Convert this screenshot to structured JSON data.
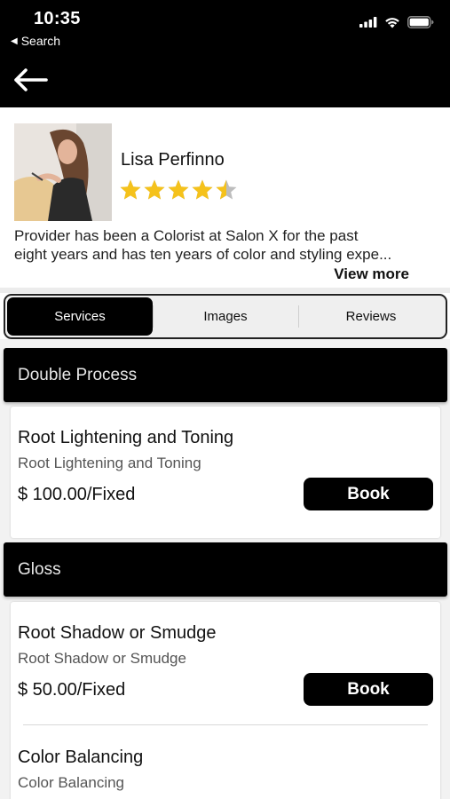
{
  "status_bar": {
    "time": "10:35",
    "back_app": "Search"
  },
  "provider": {
    "name": "Lisa Perfinno",
    "rating": 4.5,
    "rating_max": 5,
    "star_color": "#f5c21b",
    "bio_line1": "Provider has been a Colorist at Salon X for the past",
    "bio_line2": "eight years and has ten years of color and styling expe...",
    "view_more": "View more"
  },
  "tabs": [
    {
      "label": "Services",
      "active": true
    },
    {
      "label": "Images",
      "active": false
    },
    {
      "label": "Reviews",
      "active": false
    }
  ],
  "sections": [
    {
      "title": "Double Process",
      "services": [
        {
          "title": "Root Lightening and Toning",
          "subtitle": "Root Lightening and Toning",
          "price": "$ 100.00/Fixed",
          "action": "Book"
        }
      ]
    },
    {
      "title": "Gloss",
      "services": [
        {
          "title": "Root Shadow or Smudge",
          "subtitle": "Root Shadow or Smudge",
          "price": "$ 50.00/Fixed",
          "action": "Book"
        },
        {
          "title": "Color Balancing",
          "subtitle": "Color Balancing"
        }
      ]
    }
  ]
}
